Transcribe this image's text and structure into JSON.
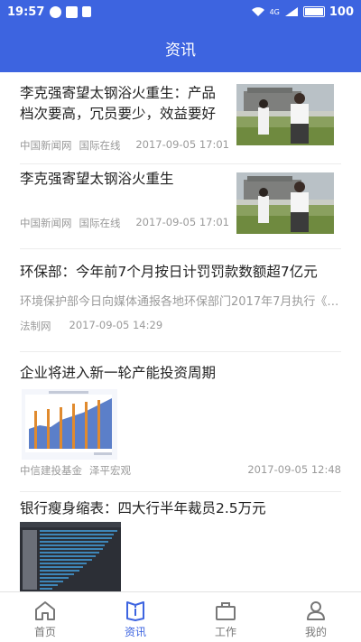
{
  "status_bar": {
    "time": "19:57",
    "battery": "100",
    "network": "4G"
  },
  "header": {
    "title": "资讯"
  },
  "news": [
    {
      "title": "李克强寄望太钢浴火重生：产品档次要高，冗员要少，效益要好",
      "source": "中国新闻网",
      "channel": "国际在线",
      "date": "2017-09-05 17:01"
    },
    {
      "title": "李克强寄望太钢浴火重生",
      "source": "中国新闻网",
      "channel": "国际在线",
      "date": "2017-09-05 17:01"
    },
    {
      "title": "环保部：今年前7个月按日计罚罚款数额超7亿元",
      "summary": "环境保护部今日向媒体通报各地环保部门2017年7月执行《…",
      "source": "法制网",
      "date": "2017-09-05 14:29"
    },
    {
      "title": "企业将进入新一轮产能投资周期",
      "source": "中信建投基金",
      "channel": "泽平宏观",
      "date": "2017-09-05 12:48"
    },
    {
      "title": "银行瘦身缩表：四大行半年裁员2.5万元"
    }
  ],
  "nav": [
    {
      "label": "首页",
      "icon": "home-icon"
    },
    {
      "label": "资讯",
      "icon": "news-book-icon"
    },
    {
      "label": "工作",
      "icon": "briefcase-icon"
    },
    {
      "label": "我的",
      "icon": "user-icon"
    }
  ],
  "colors": {
    "brand": "#3d64e0",
    "text": "#222222",
    "meta": "#9a9a9a"
  }
}
